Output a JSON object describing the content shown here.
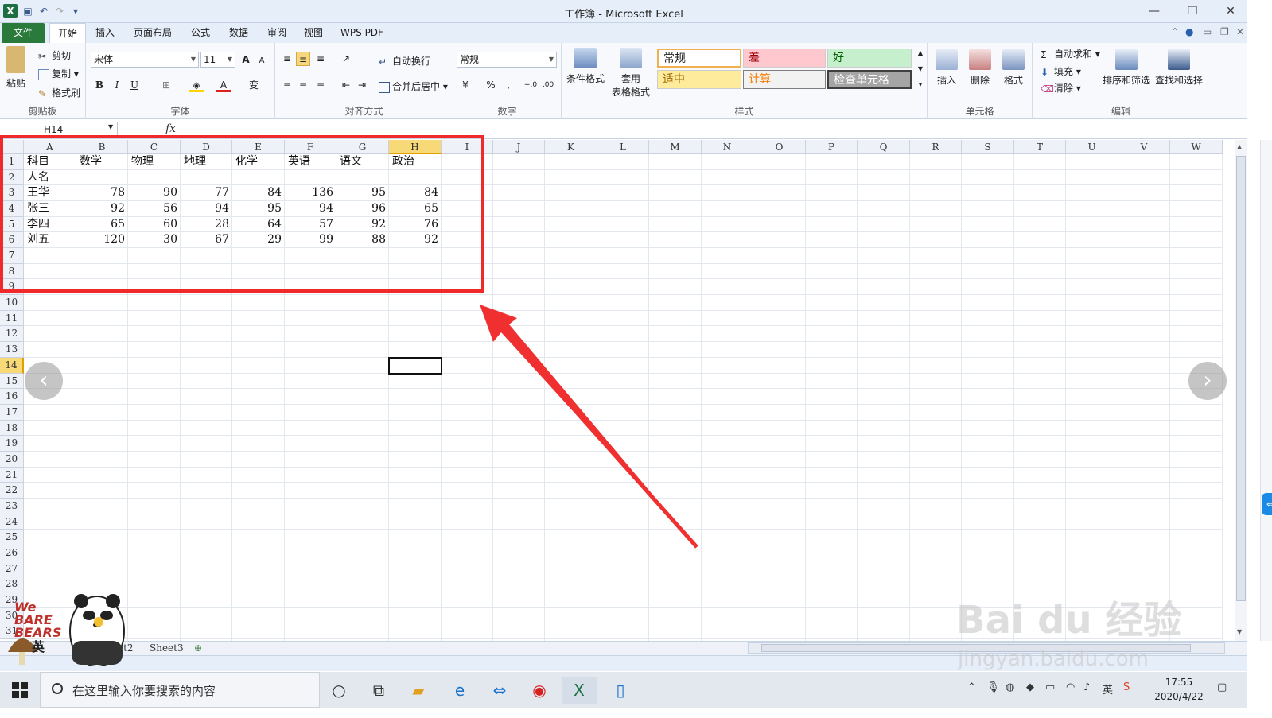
{
  "window": {
    "title": "工作簿 - Microsoft Excel",
    "minimize": "—",
    "restore": "❐",
    "close": "✕"
  },
  "tabs": [
    "文件",
    "开始",
    "插入",
    "页面布局",
    "公式",
    "数据",
    "审阅",
    "视图",
    "WPS PDF"
  ],
  "ribbon": {
    "clipboard": {
      "label": "剪贴板",
      "paste": "粘贴",
      "cut": "剪切",
      "copy": "复制",
      "format_painter": "格式刷"
    },
    "font": {
      "label": "字体",
      "name": "宋体",
      "size": "11",
      "bold": "B",
      "italic": "I",
      "underline": "U",
      "grow": "A",
      "shrink": "A",
      "phonetic": "变"
    },
    "alignment": {
      "label": "对齐方式",
      "wrap": "自动换行",
      "merge": "合并后居中"
    },
    "number": {
      "label": "数字",
      "format": "常规",
      "percent": "%",
      "comma": ","
    },
    "styles": {
      "label": "样式",
      "cond_format": "条件格式",
      "table_format_1": "套用",
      "table_format_2": "表格格式",
      "normal": "常规",
      "bad": "差",
      "good": "好",
      "neutral": "适中",
      "calc": "计算",
      "check": "检查单元格"
    },
    "cells": {
      "label": "单元格",
      "insert": "插入",
      "delete": "删除",
      "format": "格式"
    },
    "editing": {
      "label": "编辑",
      "autosum": "自动求和",
      "fill": "填充",
      "clear": "清除",
      "sort": "排序和筛选",
      "find": "查找和选择"
    }
  },
  "formula_bar": {
    "name_box": "H14",
    "fx": "fx",
    "value": ""
  },
  "columns": [
    "A",
    "B",
    "C",
    "D",
    "E",
    "F",
    "G",
    "H",
    "I",
    "J",
    "K",
    "L",
    "M",
    "N",
    "O",
    "P",
    "Q",
    "R",
    "S",
    "T",
    "U",
    "V",
    "W"
  ],
  "rows": [
    "1",
    "2",
    "3",
    "4",
    "5",
    "6",
    "7",
    "8",
    "9",
    "10",
    "11",
    "12",
    "13",
    "14",
    "15",
    "16",
    "17",
    "18",
    "19",
    "20",
    "21",
    "22",
    "23",
    "24",
    "25",
    "26",
    "27",
    "28",
    "29",
    "30",
    "31"
  ],
  "selected": {
    "cell": "H14",
    "col": "H",
    "row": "14"
  },
  "sheet": {
    "header": [
      "科目",
      "数学",
      "物理",
      "地理",
      "化学",
      "英语",
      "语文",
      "政治"
    ],
    "row2_label": "人名",
    "data": [
      {
        "name": "王华",
        "values": [
          "78",
          "90",
          "77",
          "84",
          "136",
          "95",
          "84"
        ]
      },
      {
        "name": "张三",
        "values": [
          "92",
          "56",
          "94",
          "95",
          "94",
          "96",
          "65"
        ]
      },
      {
        "name": "李四",
        "values": [
          "65",
          "60",
          "28",
          "64",
          "57",
          "92",
          "76"
        ]
      },
      {
        "name": "刘五",
        "values": [
          "120",
          "30",
          "67",
          "29",
          "99",
          "88",
          "92"
        ]
      }
    ]
  },
  "sheet_tabs": [
    "et2",
    "Sheet3"
  ],
  "mascot": {
    "logo": "We BARE BEARS",
    "badge": "英"
  },
  "watermark": {
    "brand": "Bai du 经验",
    "url": "jingyan.baidu.com"
  },
  "taskbar": {
    "search_placeholder": "在这里输入你要搜索的内容",
    "time": "17:55",
    "date": "2020/4/22",
    "ime": "英"
  },
  "colors": {
    "title_bg": "#e6eef9",
    "file_tab": "#2a7a3b",
    "highlight_red": "#f02a2a",
    "selected_header": "#f8d978"
  }
}
